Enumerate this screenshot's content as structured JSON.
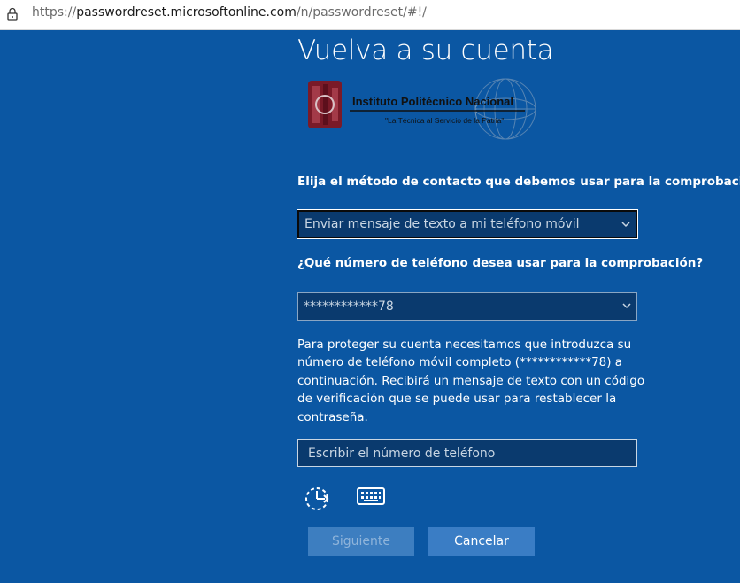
{
  "browser": {
    "url_prefix": "https://",
    "url_host": "passwordreset.microsoftonline.com",
    "url_path": "/n/passwordreset/#!/"
  },
  "page": {
    "title": "Vuelva a su cuenta",
    "logo": {
      "name": "Instituto Politécnico Nacional",
      "tagline": "\"La Técnica al Servicio de la Patria\""
    }
  },
  "form": {
    "method_label": "Elija el método de contacto que debemos usar para la comprobación:",
    "method_value": "Enviar mensaje de texto a mi teléfono móvil",
    "phone_label": "¿Qué número de teléfono desea usar para la comprobación?",
    "phone_value": "************78",
    "instructions": "Para proteger su cuenta necesitamos que introduzca su número de teléfono móvil completo (************78) a continuación. Recibirá un mensaje de texto con un código de verificación que se puede usar para restablecer la contraseña.",
    "phone_input_placeholder": "Escribir el número de teléfono"
  },
  "icons": {
    "accessibility": "timer-reset-icon",
    "keyboard": "keyboard-icon"
  },
  "buttons": {
    "next": "Siguiente",
    "cancel": "Cancelar"
  },
  "colors": {
    "background": "#0b57a3",
    "field_background": "#0a3a6e",
    "button_cancel": "#3a7dc5",
    "button_next_disabled": "#3d7ec0"
  }
}
